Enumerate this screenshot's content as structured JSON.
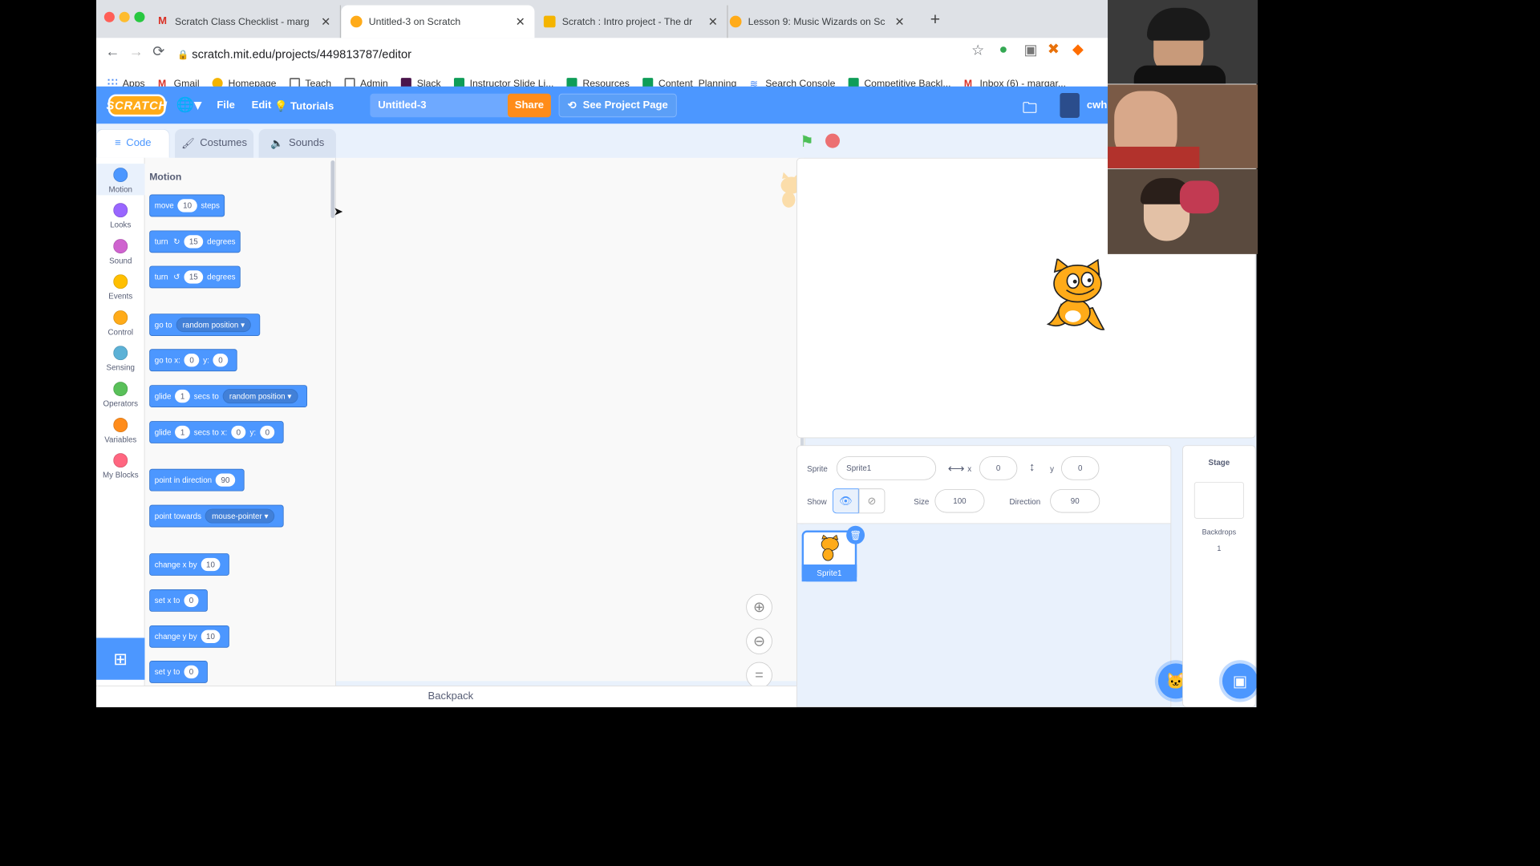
{
  "browser": {
    "tabs": [
      {
        "title": "Scratch Class Checklist - marg",
        "favicon": "gmail-icon"
      },
      {
        "title": "Untitled-3 on Scratch",
        "favicon": "scratch-icon",
        "active": true
      },
      {
        "title": "Scratch : Intro project - The dr",
        "favicon": "slides-icon"
      },
      {
        "title": "Lesson 9: Music Wizards on Sc",
        "favicon": "scratch-icon"
      }
    ],
    "url": "scratch.mit.edu/projects/449813787/editor",
    "bookmarks": [
      "Apps",
      "Gmail",
      "Homepage",
      "Teach",
      "Admin",
      "Slack",
      "Instructor Slide Li...",
      "Resources",
      "Content_Planning",
      "Search Console",
      "Competitive Backl...",
      "Inbox (6) - margar..."
    ]
  },
  "menubar": {
    "logo": "SCRATCH",
    "file": "File",
    "edit": "Edit",
    "tutorials": "Tutorials",
    "project_title": "Untitled-3",
    "share": "Share",
    "see_project": "See Project Page",
    "user": "cwh"
  },
  "editor_tabs": [
    "Code",
    "Costumes",
    "Sounds"
  ],
  "categories": [
    {
      "label": "Motion",
      "color": "#4c97ff"
    },
    {
      "label": "Looks",
      "color": "#9966ff"
    },
    {
      "label": "Sound",
      "color": "#cf63cf"
    },
    {
      "label": "Events",
      "color": "#ffbf00"
    },
    {
      "label": "Control",
      "color": "#ffab19"
    },
    {
      "label": "Sensing",
      "color": "#5cb1d6"
    },
    {
      "label": "Operators",
      "color": "#59c059"
    },
    {
      "label": "Variables",
      "color": "#ff8c1a"
    },
    {
      "label": "My Blocks",
      "color": "#ff6680"
    }
  ],
  "palette": {
    "heading": "Motion",
    "blocks": {
      "move": [
        "move",
        "10",
        "steps"
      ],
      "turn_right": [
        "turn",
        "15",
        "degrees"
      ],
      "turn_left": [
        "turn",
        "15",
        "degrees"
      ],
      "go_to": [
        "go to",
        "random position"
      ],
      "go_to_xy": [
        "go to x:",
        "0",
        "y:",
        "0"
      ],
      "glide_to": [
        "glide",
        "1",
        "secs to",
        "random position"
      ],
      "glide_xy": [
        "glide",
        "1",
        "secs to x:",
        "0",
        "y:",
        "0"
      ],
      "point_dir": [
        "point in direction",
        "90"
      ],
      "point_towards": [
        "point towards",
        "mouse-pointer"
      ],
      "change_x": [
        "change x by",
        "10"
      ],
      "set_x": [
        "set x to",
        "0"
      ],
      "change_y": [
        "change y by",
        "10"
      ],
      "set_y": [
        "set y to",
        "0"
      ]
    }
  },
  "backpack": "Backpack",
  "sprite_info": {
    "sprite_label": "Sprite",
    "sprite_name": "Sprite1",
    "x_label": "x",
    "x": "0",
    "y_label": "y",
    "y": "0",
    "show_label": "Show",
    "size_label": "Size",
    "size": "100",
    "direction_label": "Direction",
    "direction": "90"
  },
  "sprite_list": [
    {
      "name": "Sprite1",
      "selected": true
    }
  ],
  "stage_pane": {
    "title": "Stage",
    "backdrops_label": "Backdrops",
    "backdrops_count": "1"
  },
  "colors": {
    "scratch_blue": "#4c97ff",
    "orange": "#ff8c1a",
    "flag_green": "#4cbf56",
    "stop_red": "#ec5959"
  }
}
